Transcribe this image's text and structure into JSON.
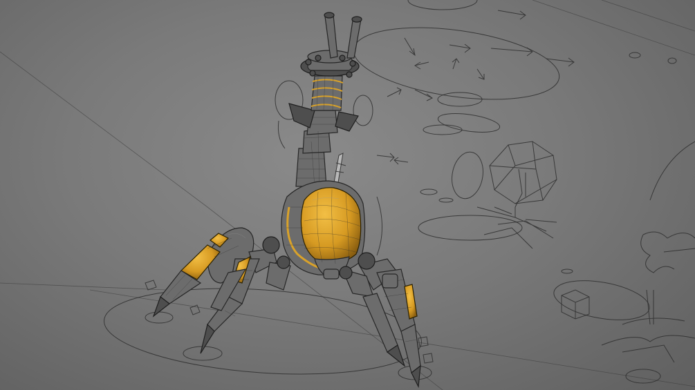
{
  "scene": {
    "subject": "",
    "colors": {
      "background_center": "#8a8a8a",
      "background_edge": "#5f5f5f",
      "rig_lines": "#2e2e2e",
      "metal": "#6c6c6c",
      "accent_gold": "#e0a62a"
    }
  }
}
